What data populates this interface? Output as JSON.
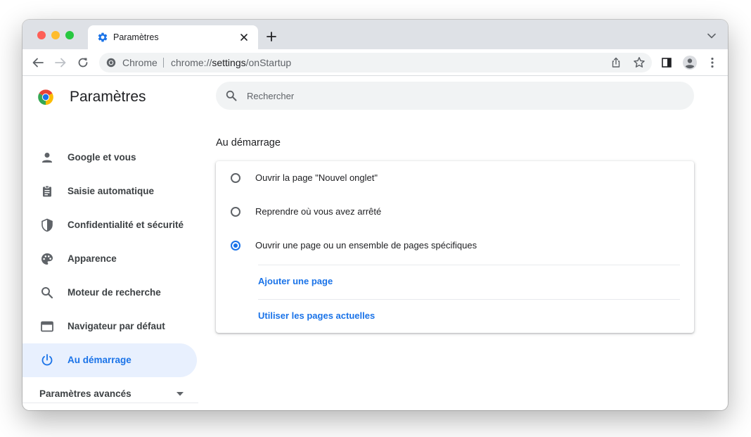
{
  "window": {
    "tab": {
      "title": "Paramètres",
      "icon": "gear-icon"
    }
  },
  "toolbar": {
    "omnibox": {
      "chip": "Chrome",
      "url_scheme": "chrome://",
      "url_host": "settings",
      "url_path": "/onStartup"
    }
  },
  "sidebar": {
    "title": "Paramètres",
    "items": [
      {
        "label": "Google et vous",
        "icon": "person-icon"
      },
      {
        "label": "Saisie automatique",
        "icon": "clipboard-icon"
      },
      {
        "label": "Confidentialité et sécurité",
        "icon": "shield-icon"
      },
      {
        "label": "Apparence",
        "icon": "palette-icon"
      },
      {
        "label": "Moteur de recherche",
        "icon": "search-icon"
      },
      {
        "label": "Navigateur par défaut",
        "icon": "browser-window-icon"
      },
      {
        "label": "Au démarrage",
        "icon": "power-icon",
        "active": true
      }
    ],
    "advanced": "Paramètres avancés"
  },
  "main": {
    "search_placeholder": "Rechercher",
    "section_title": "Au démarrage",
    "options": [
      {
        "label": "Ouvrir la page \"Nouvel onglet\"",
        "checked": false
      },
      {
        "label": "Reprendre où vous avez arrêté",
        "checked": false
      },
      {
        "label": "Ouvrir une page ou un ensemble de pages spécifiques",
        "checked": true
      }
    ],
    "links": {
      "add_page": "Ajouter une page",
      "use_current": "Utiliser les pages actuelles"
    }
  },
  "colors": {
    "accent": "#1a73e8",
    "active_nav_bg": "#e8f0fe",
    "tabstrip_bg": "#dee1e6"
  }
}
